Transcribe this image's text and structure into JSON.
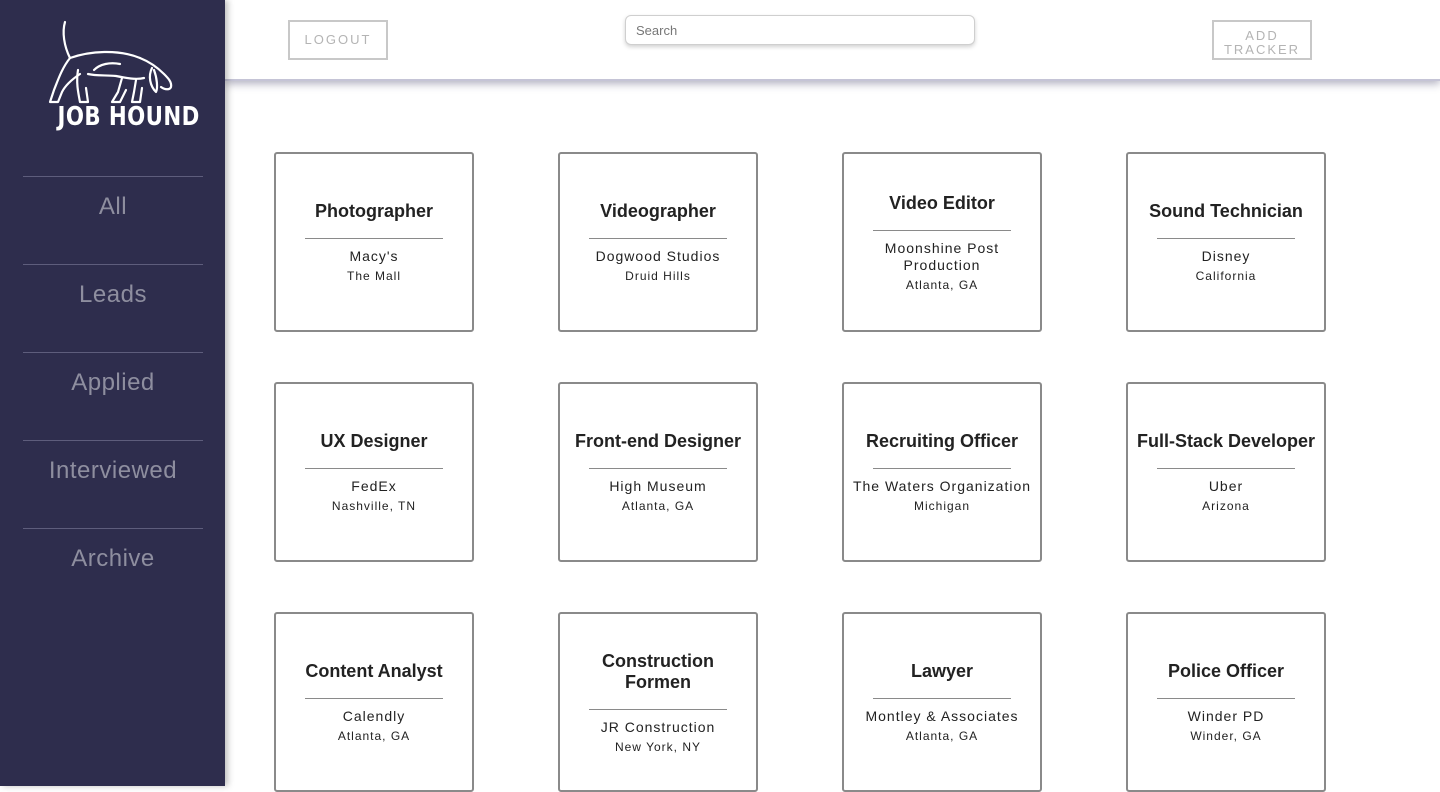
{
  "app": {
    "logo_text": "JOB HOUND",
    "logo_icon": "hound-dog-icon"
  },
  "sidebar": {
    "items": [
      {
        "label": "All"
      },
      {
        "label": "Leads"
      },
      {
        "label": "Applied"
      },
      {
        "label": "Interviewed"
      },
      {
        "label": "Archive"
      }
    ]
  },
  "header": {
    "logout_label": "LOGOUT",
    "search_placeholder": "Search",
    "search_value": "",
    "add_tracker_label": "ADD TRACKER"
  },
  "jobs": [
    {
      "title": "Photographer",
      "company": "Macy's",
      "location": "The Mall"
    },
    {
      "title": "Videographer",
      "company": "Dogwood Studios",
      "location": "Druid Hills"
    },
    {
      "title": "Video Editor",
      "company": "Moonshine Post Production",
      "location": "Atlanta, GA"
    },
    {
      "title": "Sound Technician",
      "company": "Disney",
      "location": "California"
    },
    {
      "title": "UX Designer",
      "company": "FedEx",
      "location": "Nashville, TN"
    },
    {
      "title": "Front-end Designer",
      "company": "High Museum",
      "location": "Atlanta, GA"
    },
    {
      "title": "Recruiting Officer",
      "company": "The Waters Organization",
      "location": "Michigan"
    },
    {
      "title": "Full-Stack Developer",
      "company": "Uber",
      "location": "Arizona"
    },
    {
      "title": "Content Analyst",
      "company": "Calendly",
      "location": "Atlanta, GA"
    },
    {
      "title": "Construction Formen",
      "company": "JR Construction",
      "location": "New York, NY"
    },
    {
      "title": "Lawyer",
      "company": "Montley & Associates",
      "location": "Atlanta, GA"
    },
    {
      "title": "Police Officer",
      "company": "Winder PD",
      "location": "Winder, GA"
    }
  ],
  "colors": {
    "sidebar_bg": "#2e2d4d",
    "nav_text": "#8e8e9f",
    "card_border": "#8a8a8a",
    "button_border": "#c8c8c8"
  }
}
